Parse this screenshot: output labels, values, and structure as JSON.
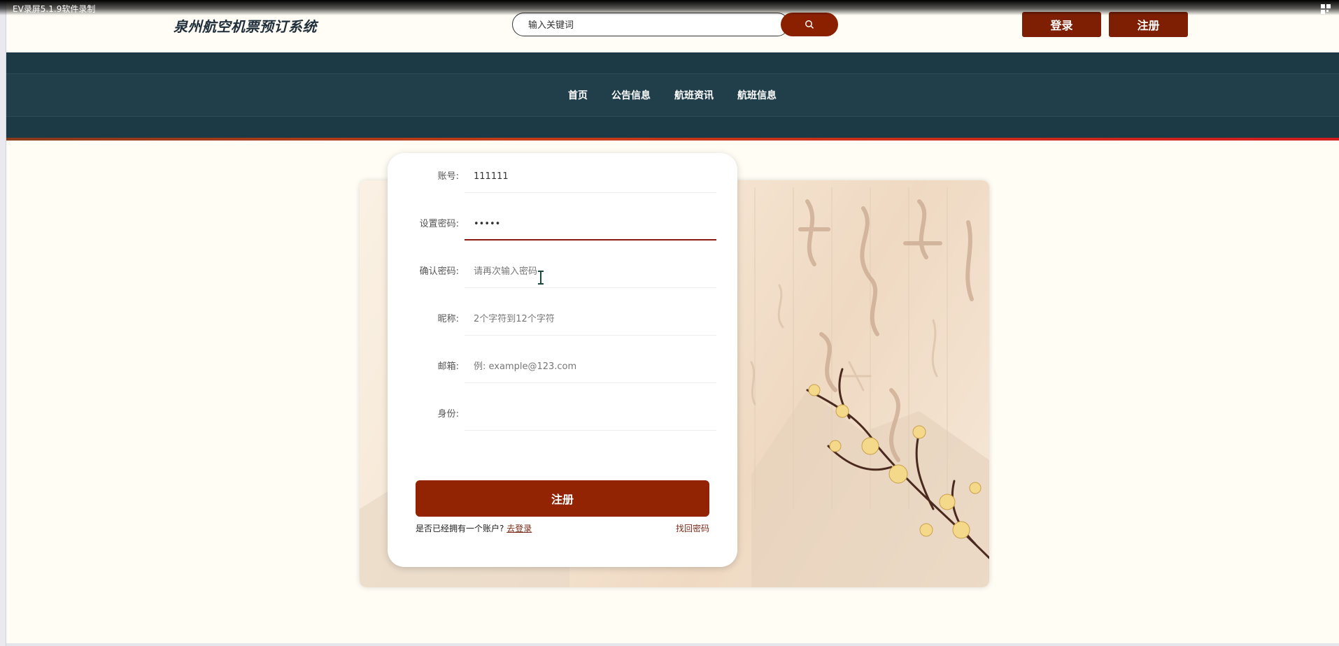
{
  "recorder": {
    "title": "EV录屏5.1.9软件录制"
  },
  "header": {
    "site_title": "泉州航空机票预订系统",
    "search_placeholder": "输入关键词",
    "login_label": "登录",
    "register_label": "注册"
  },
  "nav": {
    "items": [
      "首页",
      "公告信息",
      "航班资讯",
      "航班信息"
    ]
  },
  "form": {
    "fields": [
      {
        "label": "账号:",
        "value": "111111",
        "placeholder": ""
      },
      {
        "label": "设置密码:",
        "value": "•••••",
        "placeholder": ""
      },
      {
        "label": "确认密码:",
        "value": "",
        "placeholder": "请再次输入密码"
      },
      {
        "label": "昵称:",
        "value": "",
        "placeholder": "2个字符到12个字符"
      },
      {
        "label": "邮箱:",
        "value": "",
        "placeholder": "例: example@123.com"
      },
      {
        "label": "身份:",
        "value": "",
        "placeholder": ""
      }
    ],
    "submit_label": "注册",
    "has_account_text": "是否已经拥有一个账户?",
    "go_login_label": "去登录",
    "forgot_label": "找回密码"
  },
  "colors": {
    "accent": "#922303",
    "nav_bg": "#1b3a46",
    "page_bg": "#fffdf4"
  }
}
